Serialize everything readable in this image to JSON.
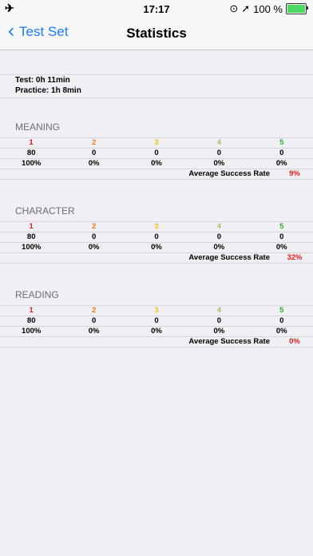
{
  "status": {
    "time": "17:17",
    "battery": "100 %"
  },
  "nav": {
    "back_label": "Test Set",
    "title": "Statistics"
  },
  "times": {
    "test": "Test: 0h 11min",
    "practice": "Practice: 1h 8min"
  },
  "sections": [
    {
      "title": "MEANING",
      "levels": [
        "1",
        "2",
        "3",
        "4",
        "5"
      ],
      "counts": [
        "80",
        "0",
        "0",
        "0",
        "0"
      ],
      "percents": [
        "100%",
        "0%",
        "0%",
        "0%",
        "0%"
      ],
      "avg_label": "Average Success Rate",
      "avg_value": "9%"
    },
    {
      "title": "CHARACTER",
      "levels": [
        "1",
        "2",
        "3",
        "4",
        "5"
      ],
      "counts": [
        "80",
        "0",
        "0",
        "0",
        "0"
      ],
      "percents": [
        "100%",
        "0%",
        "0%",
        "0%",
        "0%"
      ],
      "avg_label": "Average Success Rate",
      "avg_value": "32%"
    },
    {
      "title": "READING",
      "levels": [
        "1",
        "2",
        "3",
        "4",
        "5"
      ],
      "counts": [
        "80",
        "0",
        "0",
        "0",
        "0"
      ],
      "percents": [
        "100%",
        "0%",
        "0%",
        "0%",
        "0%"
      ],
      "avg_label": "Average Success Rate",
      "avg_value": "0%"
    }
  ],
  "colors": {
    "accent": "#1a7cf5",
    "level1": "#e02020",
    "level2": "#f07a18",
    "level3": "#f2c318",
    "level4": "#b8b868",
    "level5": "#2aba2a"
  }
}
